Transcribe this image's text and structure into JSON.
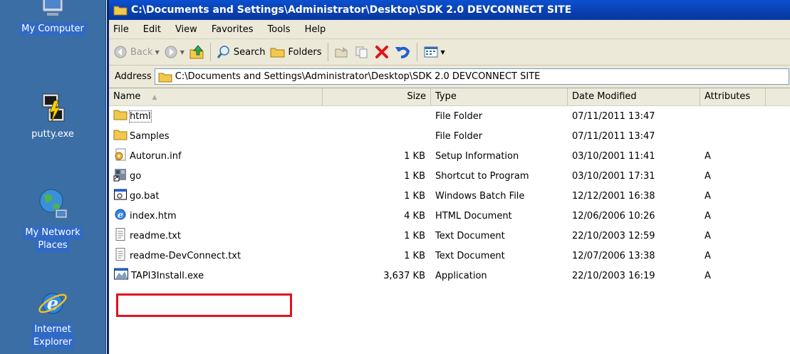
{
  "desktop": {
    "icons": [
      {
        "label": "My Computer",
        "icon": "my-computer-icon"
      },
      {
        "label": "putty.exe",
        "icon": "putty-icon"
      },
      {
        "label": "My Network Places",
        "label_lines": [
          "My Network",
          "Places"
        ],
        "icon": "network-places-icon"
      },
      {
        "label": "Internet Explorer",
        "label_lines": [
          "Internet",
          "Explorer"
        ],
        "icon": "internet-explorer-icon"
      }
    ]
  },
  "window": {
    "title": "C:\\Documents and Settings\\Administrator\\Desktop\\SDK 2.0 DEVCONNECT SITE",
    "title_color": "#0a46c8"
  },
  "menu": {
    "items": [
      "File",
      "Edit",
      "View",
      "Favorites",
      "Tools",
      "Help"
    ]
  },
  "toolbar": {
    "back_label": "Back",
    "search_label": "Search",
    "folders_label": "Folders",
    "icons": [
      "back-icon",
      "forward-icon",
      "up-folder-icon",
      "search-icon",
      "folders-icon",
      "move-to-icon",
      "copy-to-icon",
      "delete-icon",
      "undo-icon",
      "views-icon"
    ]
  },
  "address": {
    "label": "Address",
    "value": "C:\\Documents and Settings\\Administrator\\Desktop\\SDK 2.0 DEVCONNECT SITE"
  },
  "columns": {
    "name": "Name",
    "size": "Size",
    "type": "Type",
    "date": "Date Modified",
    "attributes": "Attributes"
  },
  "files": [
    {
      "name": "html",
      "size": "",
      "type": "File Folder",
      "date": "07/11/2011 13:47",
      "attr": "",
      "icon": "folder-icon"
    },
    {
      "name": "Samples",
      "size": "",
      "type": "File Folder",
      "date": "07/11/2011 13:47",
      "attr": "",
      "icon": "folder-icon"
    },
    {
      "name": "Autorun.inf",
      "size": "1 KB",
      "type": "Setup Information",
      "date": "03/10/2001 11:41",
      "attr": "A",
      "icon": "setup-info-icon"
    },
    {
      "name": "go",
      "size": "1 KB",
      "type": "Shortcut to Program",
      "date": "03/10/2001 17:31",
      "attr": "A",
      "icon": "program-shortcut-icon"
    },
    {
      "name": "go.bat",
      "size": "1 KB",
      "type": "Windows Batch File",
      "date": "12/12/2001 16:38",
      "attr": "A",
      "icon": "batch-file-icon"
    },
    {
      "name": "index.htm",
      "size": "4 KB",
      "type": "HTML Document",
      "date": "12/06/2006 10:26",
      "attr": "A",
      "icon": "ie-document-icon"
    },
    {
      "name": "readme.txt",
      "size": "1 KB",
      "type": "Text Document",
      "date": "22/10/2003 12:59",
      "attr": "A",
      "icon": "text-document-icon"
    },
    {
      "name": "readme-DevConnect.txt",
      "size": "1 KB",
      "type": "Text Document",
      "date": "12/07/2006 13:38",
      "attr": "A",
      "icon": "text-document-icon"
    },
    {
      "name": "TAPI3Install.exe",
      "size": "3,637 KB",
      "type": "Application",
      "date": "22/10/2003 16:19",
      "attr": "A",
      "icon": "installer-app-icon"
    }
  ],
  "highlight_color": "#e0141e"
}
